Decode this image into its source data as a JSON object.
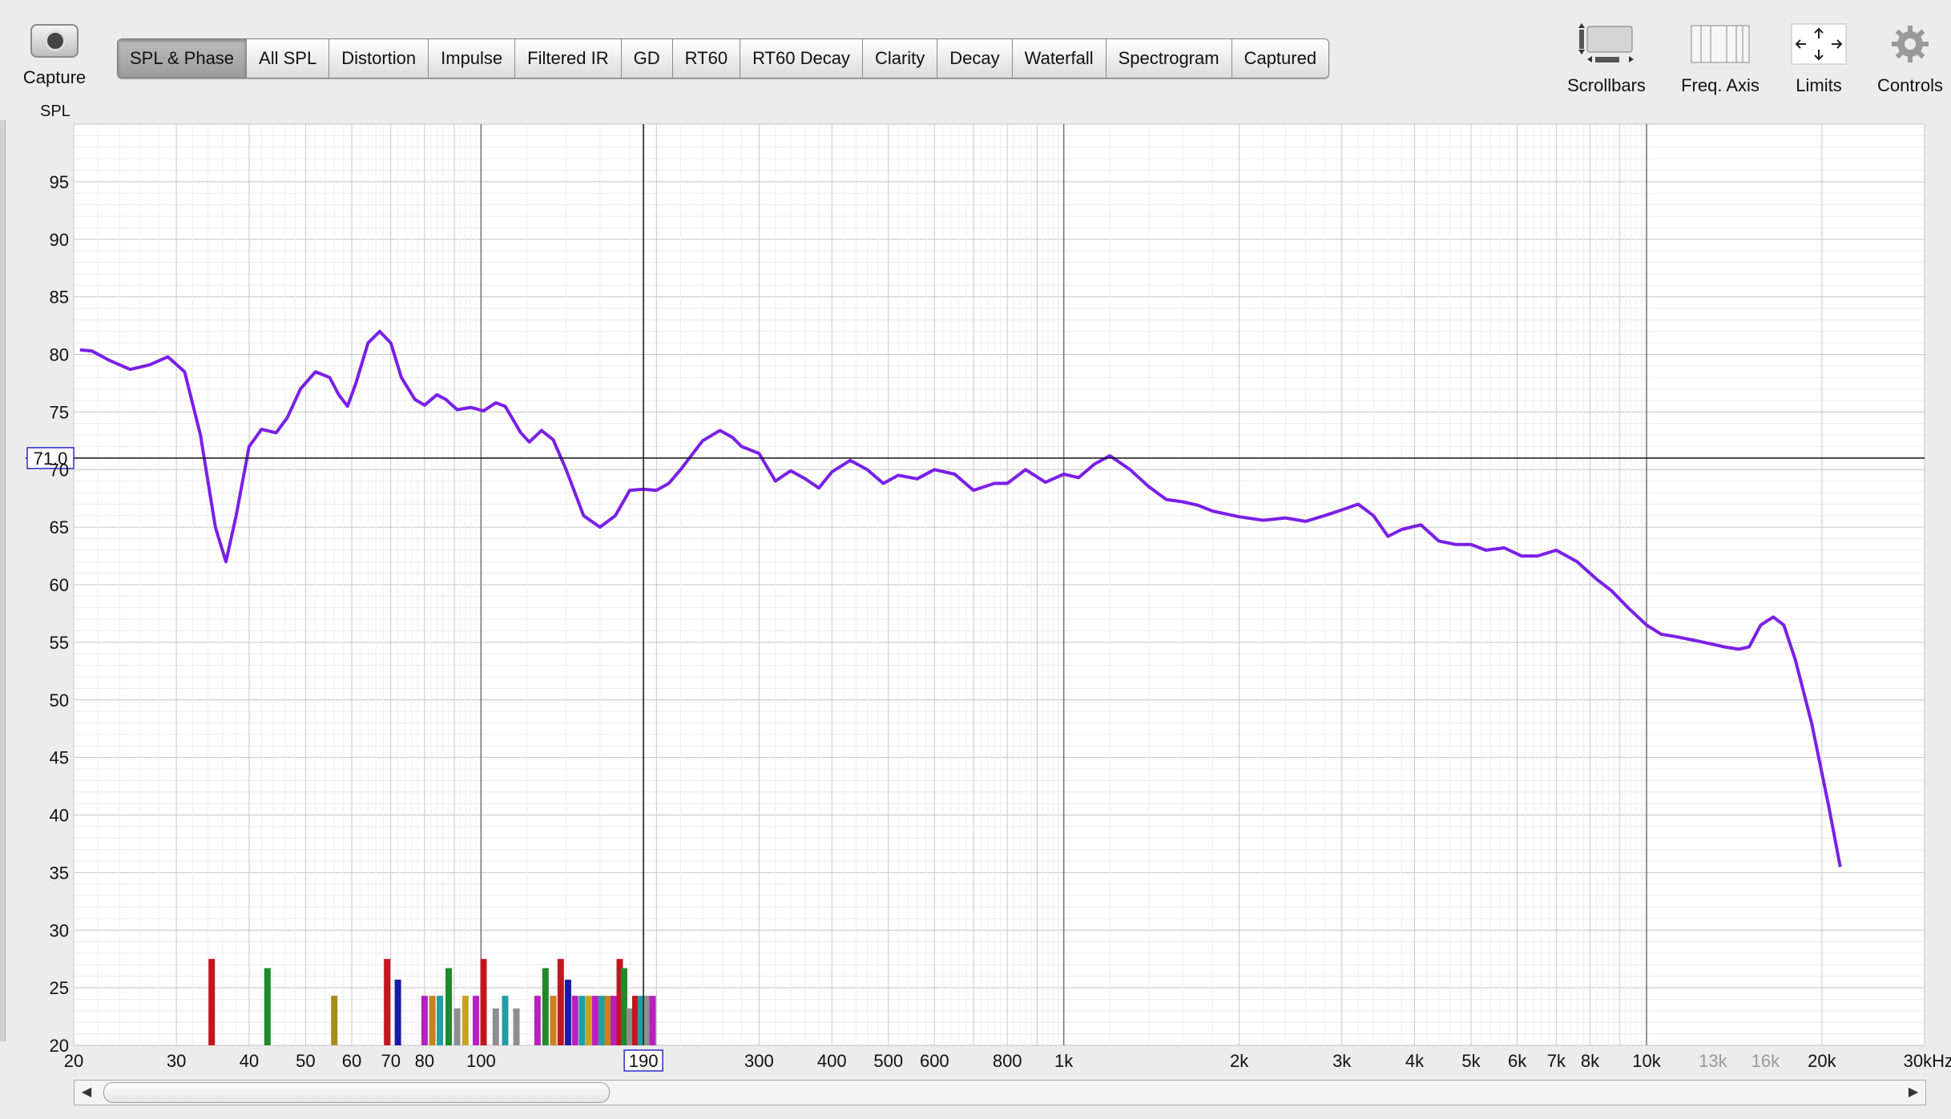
{
  "toolbar": {
    "capture_label": "Capture",
    "tabs": [
      "SPL & Phase",
      "All SPL",
      "Distortion",
      "Impulse",
      "Filtered IR",
      "GD",
      "RT60",
      "RT60 Decay",
      "Clarity",
      "Decay",
      "Waterfall",
      "Spectrogram",
      "Captured"
    ],
    "active_tab": "SPL & Phase",
    "right_tools": [
      "Scrollbars",
      "Freq. Axis",
      "Limits",
      "Controls"
    ]
  },
  "chart_data": {
    "type": "line",
    "ylabel": "SPL",
    "x_scale": "log",
    "xlim": [
      20,
      30000
    ],
    "ylim": [
      20,
      100
    ],
    "y_ticks": [
      95,
      90,
      85,
      80,
      75,
      70,
      65,
      60,
      55,
      50,
      45,
      40,
      35,
      30,
      25,
      20
    ],
    "x_tick_labels": [
      {
        "f": 20,
        "label": "20"
      },
      {
        "f": 30,
        "label": "30"
      },
      {
        "f": 40,
        "label": "40"
      },
      {
        "f": 50,
        "label": "50"
      },
      {
        "f": 60,
        "label": "60"
      },
      {
        "f": 70,
        "label": "70"
      },
      {
        "f": 80,
        "label": "80"
      },
      {
        "f": 100,
        "label": "100"
      },
      {
        "f": 300,
        "label": "300"
      },
      {
        "f": 400,
        "label": "400"
      },
      {
        "f": 500,
        "label": "500"
      },
      {
        "f": 600,
        "label": "600"
      },
      {
        "f": 800,
        "label": "800"
      },
      {
        "f": 1000,
        "label": "1k"
      },
      {
        "f": 2000,
        "label": "2k"
      },
      {
        "f": 3000,
        "label": "3k"
      },
      {
        "f": 4000,
        "label": "4k"
      },
      {
        "f": 5000,
        "label": "5k"
      },
      {
        "f": 6000,
        "label": "6k"
      },
      {
        "f": 7000,
        "label": "7k"
      },
      {
        "f": 8000,
        "label": "8k"
      },
      {
        "f": 10000,
        "label": "10k"
      },
      {
        "f": 13000,
        "label": "13k",
        "dim": true
      },
      {
        "f": 16000,
        "label": "16k",
        "dim": true
      },
      {
        "f": 20000,
        "label": "20k"
      },
      {
        "f": 30000,
        "label": "30kHz"
      }
    ],
    "cursor": {
      "x_label": "190",
      "y_label": "71.0",
      "x": 190,
      "y": 71.0
    },
    "series": [
      {
        "color": "#7a1fe8",
        "points": [
          [
            20.5,
            80.4
          ],
          [
            21.5,
            80.3
          ],
          [
            23,
            79.5
          ],
          [
            25,
            78.7
          ],
          [
            27,
            79.1
          ],
          [
            29,
            79.8
          ],
          [
            31,
            78.5
          ],
          [
            33,
            73
          ],
          [
            35,
            65
          ],
          [
            36.5,
            62
          ],
          [
            38,
            66
          ],
          [
            40,
            72
          ],
          [
            42,
            73.5
          ],
          [
            44.5,
            73.2
          ],
          [
            46.5,
            74.5
          ],
          [
            49,
            77
          ],
          [
            52,
            78.5
          ],
          [
            55,
            78
          ],
          [
            57,
            76.5
          ],
          [
            59,
            75.5
          ],
          [
            61,
            77.5
          ],
          [
            64,
            81
          ],
          [
            67,
            82
          ],
          [
            70,
            81
          ],
          [
            73,
            78
          ],
          [
            77,
            76.1
          ],
          [
            80,
            75.6
          ],
          [
            84,
            76.5
          ],
          [
            87,
            76.1
          ],
          [
            91,
            75.2
          ],
          [
            96,
            75.4
          ],
          [
            101,
            75.1
          ],
          [
            106,
            75.8
          ],
          [
            110,
            75.5
          ],
          [
            117,
            73.2
          ],
          [
            121,
            72.4
          ],
          [
            127,
            73.4
          ],
          [
            133,
            72.6
          ],
          [
            140,
            70
          ],
          [
            150,
            66
          ],
          [
            160,
            65
          ],
          [
            170,
            66
          ],
          [
            180,
            68.2
          ],
          [
            190,
            68.3
          ],
          [
            200,
            68.2
          ],
          [
            210,
            68.8
          ],
          [
            220,
            70
          ],
          [
            240,
            72.5
          ],
          [
            257,
            73.4
          ],
          [
            270,
            72.8
          ],
          [
            280,
            72
          ],
          [
            300,
            71.4
          ],
          [
            320,
            69
          ],
          [
            340,
            69.9
          ],
          [
            360,
            69.2
          ],
          [
            380,
            68.4
          ],
          [
            400,
            69.8
          ],
          [
            430,
            70.8
          ],
          [
            460,
            70
          ],
          [
            490,
            68.8
          ],
          [
            520,
            69.5
          ],
          [
            560,
            69.2
          ],
          [
            600,
            70
          ],
          [
            650,
            69.6
          ],
          [
            700,
            68.2
          ],
          [
            760,
            68.8
          ],
          [
            800,
            68.8
          ],
          [
            860,
            70
          ],
          [
            930,
            68.9
          ],
          [
            1000,
            69.6
          ],
          [
            1060,
            69.3
          ],
          [
            1130,
            70.5
          ],
          [
            1200,
            71.2
          ],
          [
            1300,
            70
          ],
          [
            1400,
            68.5
          ],
          [
            1500,
            67.4
          ],
          [
            1600,
            67.2
          ],
          [
            1700,
            66.9
          ],
          [
            1800,
            66.4
          ],
          [
            2000,
            65.9
          ],
          [
            2200,
            65.6
          ],
          [
            2400,
            65.8
          ],
          [
            2600,
            65.5
          ],
          [
            2800,
            66
          ],
          [
            3000,
            66.5
          ],
          [
            3200,
            67
          ],
          [
            3400,
            66
          ],
          [
            3600,
            64.2
          ],
          [
            3800,
            64.8
          ],
          [
            4100,
            65.2
          ],
          [
            4400,
            63.8
          ],
          [
            4700,
            63.5
          ],
          [
            5000,
            63.5
          ],
          [
            5300,
            63
          ],
          [
            5700,
            63.2
          ],
          [
            6100,
            62.5
          ],
          [
            6500,
            62.5
          ],
          [
            7000,
            63
          ],
          [
            7600,
            62
          ],
          [
            8200,
            60.5
          ],
          [
            8700,
            59.5
          ],
          [
            9300,
            58
          ],
          [
            10000,
            56.5
          ],
          [
            10600,
            55.7
          ],
          [
            11200,
            55.5
          ],
          [
            12000,
            55.2
          ],
          [
            12800,
            54.9
          ],
          [
            13600,
            54.6
          ],
          [
            14400,
            54.4
          ],
          [
            15000,
            54.6
          ],
          [
            15700,
            56.5
          ],
          [
            16500,
            57.2
          ],
          [
            17200,
            56.5
          ],
          [
            18000,
            53.5
          ],
          [
            19200,
            48
          ],
          [
            20500,
            41
          ],
          [
            21500,
            35.5
          ]
        ]
      }
    ],
    "bars": [
      {
        "f": 34.5,
        "value": 27.5,
        "color": "#c2151e"
      },
      {
        "f": 43,
        "value": 26.7,
        "color": "#1f8a2b"
      },
      {
        "f": 56,
        "value": 24.3,
        "color": "#a68a1c"
      },
      {
        "f": 69,
        "value": 27.5,
        "color": "#c2151e"
      },
      {
        "f": 72,
        "value": 25.7,
        "color": "#1a1aa8"
      },
      {
        "f": 80,
        "value": 24.3,
        "color": "#b81fbf"
      },
      {
        "f": 82.5,
        "value": 24.3,
        "color": "#c9821c"
      },
      {
        "f": 85,
        "value": 24.3,
        "color": "#1f9fa6"
      },
      {
        "f": 88,
        "value": 26.7,
        "color": "#1f8a2b"
      },
      {
        "f": 91,
        "value": 23.2,
        "color": "#8e8e8e"
      },
      {
        "f": 94,
        "value": 24.3,
        "color": "#c9a21c"
      },
      {
        "f": 98,
        "value": 24.3,
        "color": "#b81fbf"
      },
      {
        "f": 101,
        "value": 27.5,
        "color": "#c2151e"
      },
      {
        "f": 106,
        "value": 23.2,
        "color": "#8e8e8e"
      },
      {
        "f": 110,
        "value": 24.3,
        "color": "#1f9fa6"
      },
      {
        "f": 115,
        "value": 23.2,
        "color": "#8e8e8e"
      },
      {
        "f": 125,
        "value": 24.3,
        "color": "#b81fbf"
      },
      {
        "f": 129,
        "value": 26.7,
        "color": "#1f8a2b"
      },
      {
        "f": 133,
        "value": 24.3,
        "color": "#c9821c"
      },
      {
        "f": 137,
        "value": 27.5,
        "color": "#c2151e"
      },
      {
        "f": 141,
        "value": 25.7,
        "color": "#1a1aa8"
      },
      {
        "f": 145,
        "value": 24.3,
        "color": "#b81fbf"
      },
      {
        "f": 149,
        "value": 24.3,
        "color": "#1f9fa6"
      },
      {
        "f": 153,
        "value": 24.3,
        "color": "#c9a21c"
      },
      {
        "f": 157,
        "value": 24.3,
        "color": "#b81fbf"
      },
      {
        "f": 161,
        "value": 24.3,
        "color": "#1f9fa6"
      },
      {
        "f": 165,
        "value": 24.3,
        "color": "#c9821c"
      },
      {
        "f": 169,
        "value": 24.3,
        "color": "#b81fbf"
      },
      {
        "f": 173,
        "value": 27.5,
        "color": "#c2151e"
      },
      {
        "f": 176,
        "value": 26.7,
        "color": "#1f8a2b"
      },
      {
        "f": 180,
        "value": 23.2,
        "color": "#8e8e8e"
      },
      {
        "f": 184,
        "value": 24.3,
        "color": "#c2151e"
      },
      {
        "f": 188,
        "value": 24.3,
        "color": "#1f9fa6"
      },
      {
        "f": 193,
        "value": 24.3,
        "color": "#8e8e8e"
      },
      {
        "f": 197,
        "value": 24.3,
        "color": "#b81fbf"
      }
    ]
  }
}
